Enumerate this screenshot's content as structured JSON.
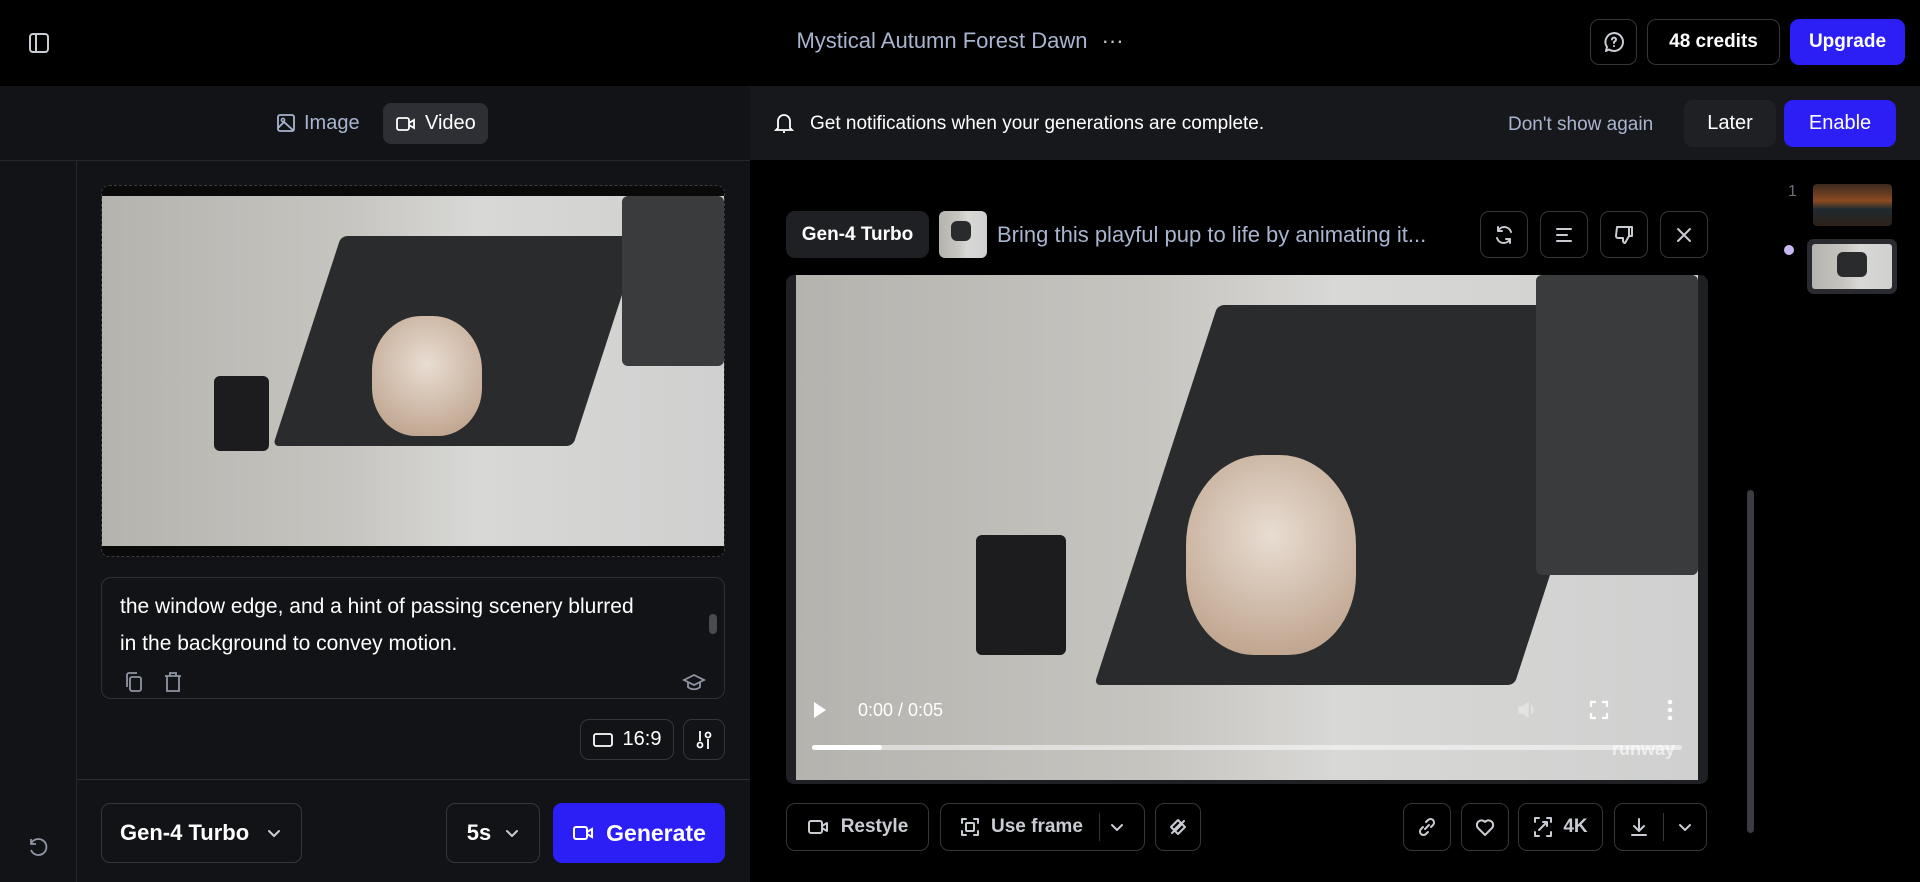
{
  "header": {
    "title": "Mystical Autumn Forest Dawn",
    "more": "···",
    "credits": "48 credits",
    "upgrade": "Upgrade"
  },
  "mode_tabs": [
    {
      "label": "Image"
    },
    {
      "label": "Video",
      "active": true
    }
  ],
  "prompt": {
    "text": "the window edge, and a hint of passing scenery blurred in the background to convey motion."
  },
  "settings": {
    "aspect_ratio": "16:9",
    "model": "Gen-4 Turbo",
    "duration": "5s",
    "generate": "Generate"
  },
  "notification": {
    "text": "Get notifications when your generations are complete.",
    "dont_show": "Don't show again",
    "later": "Later",
    "enable": "Enable"
  },
  "generation": {
    "model": "Gen-4 Turbo",
    "prompt": "Bring this playful pup to life by animating it...",
    "time": "0:00 / 0:05",
    "progress": 0.08,
    "watermark": "runway"
  },
  "actions": {
    "restyle": "Restyle",
    "use_frame": "Use frame",
    "upscale": "4K"
  },
  "history": {
    "group_number": "1"
  },
  "colors": {
    "accent": "#2b1ff5",
    "panel": "#121316"
  }
}
